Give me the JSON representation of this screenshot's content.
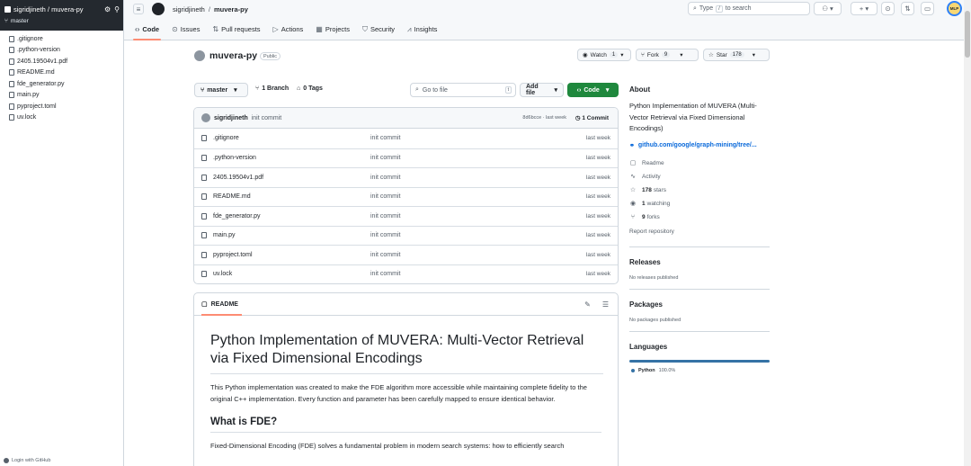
{
  "left_sidebar": {
    "repo_path": "sigridjineth / muvera-py",
    "branch": "master",
    "files": [
      ".gitignore",
      ".python-version",
      "2405.19504v1.pdf",
      "README.md",
      "fde_generator.py",
      "main.py",
      "pyproject.toml",
      "uv.lock"
    ],
    "footer": "Login with GitHub"
  },
  "header": {
    "owner": "sigridjineth",
    "separator": "/",
    "repo": "muvera-py",
    "search_placeholder": "Type",
    "search_key": "/",
    "search_suffix": "to search",
    "avatar_text": "MLP"
  },
  "tabs": [
    {
      "label": "Code",
      "icon": "code-icon"
    },
    {
      "label": "Issues",
      "icon": "issue-icon"
    },
    {
      "label": "Pull requests",
      "icon": "pull-request-icon"
    },
    {
      "label": "Actions",
      "icon": "actions-icon"
    },
    {
      "label": "Projects",
      "icon": "projects-icon"
    },
    {
      "label": "Security",
      "icon": "shield-icon"
    },
    {
      "label": "Insights",
      "icon": "graph-icon"
    }
  ],
  "repo": {
    "name": "muvera-py",
    "visibility": "Public",
    "watch_label": "Watch",
    "watch_count": "1",
    "fork_label": "Fork",
    "fork_count": "9",
    "star_label": "Star",
    "star_count": "178"
  },
  "toolbar": {
    "branch": "master",
    "branches": "1 Branch",
    "tags": "0 Tags",
    "goto_placeholder": "Go to file",
    "goto_key": "t",
    "add_file": "Add file",
    "code": "Code"
  },
  "commit": {
    "user": "sigridjineth",
    "message": "init commit",
    "hash_time": "8d6bcce · last week",
    "count": "1 Commit"
  },
  "file_rows": [
    {
      "name": ".gitignore",
      "message": "init commit",
      "time": "last week"
    },
    {
      "name": ".python-version",
      "message": "init commit",
      "time": "last week"
    },
    {
      "name": "2405.19504v1.pdf",
      "message": "init commit",
      "time": "last week"
    },
    {
      "name": "README.md",
      "message": "init commit",
      "time": "last week"
    },
    {
      "name": "fde_generator.py",
      "message": "init commit",
      "time": "last week"
    },
    {
      "name": "main.py",
      "message": "init commit",
      "time": "last week"
    },
    {
      "name": "pyproject.toml",
      "message": "init commit",
      "time": "last week"
    },
    {
      "name": "uv.lock",
      "message": "init commit",
      "time": "last week"
    }
  ],
  "readme": {
    "tab": "README",
    "h1": "Python Implementation of MUVERA: Multi-Vector Retrieval via Fixed Dimensional Encodings",
    "p1": "This Python implementation was created to make the FDE algorithm more accessible while maintaining complete fidelity to the original C++ implementation. Every function and parameter has been carefully mapped to ensure identical behavior.",
    "h2": "What is FDE?",
    "p2": "Fixed-Dimensional Encoding (FDE) solves a fundamental problem in modern search systems: how to efficiently search"
  },
  "about": {
    "heading": "About",
    "description": "Python Implementation of MUVERA (Multi-Vector Retrieval via Fixed Dimensional Encodings)",
    "link": "github.com/google/graph-mining/tree/...",
    "readme": "Readme",
    "activity": "Activity",
    "stars_num": "178",
    "stars_label": "stars",
    "watching_num": "1",
    "watching_label": "watching",
    "forks_num": "9",
    "forks_label": "forks",
    "report": "Report repository"
  },
  "releases": {
    "heading": "Releases",
    "text": "No releases published"
  },
  "packages": {
    "heading": "Packages",
    "text": "No packages published"
  },
  "languages": {
    "heading": "Languages",
    "name": "Python",
    "percent": "100.0%",
    "fraction": 1.0,
    "color": "#3572a5"
  },
  "colors": {
    "accent_tab": "#fd8c73",
    "code_button": "#1f883d",
    "link": "#0969da"
  }
}
